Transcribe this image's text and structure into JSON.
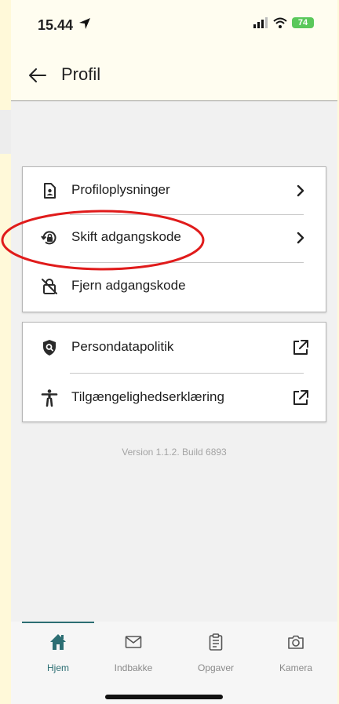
{
  "status": {
    "time": "15.44",
    "battery": "74"
  },
  "appbar": {
    "title": "Profil"
  },
  "card1": {
    "items": [
      {
        "label": "Profiloplysninger",
        "icon": "profile-document-icon",
        "trail": "chevron-right-icon"
      },
      {
        "label": "Skift adgangskode",
        "icon": "lock-rotate-icon",
        "trail": "chevron-right-icon"
      },
      {
        "label": "Fjern adgangskode",
        "icon": "lock-remove-icon"
      }
    ]
  },
  "card2": {
    "items": [
      {
        "label": "Persondatapolitik",
        "icon": "shield-icon",
        "trail": "external-link-icon"
      },
      {
        "label": "Tilgængelighedserklæring",
        "icon": "accessibility-icon",
        "trail": "external-link-icon"
      }
    ]
  },
  "version": "Version 1.1.2. Build 6893",
  "nav": [
    {
      "label": "Hjem",
      "icon": "home-icon",
      "active": true
    },
    {
      "label": "Indbakke",
      "icon": "mail-icon",
      "active": false
    },
    {
      "label": "Opgaver",
      "icon": "clipboard-icon",
      "active": false
    },
    {
      "label": "Kamera",
      "icon": "camera-icon",
      "active": false
    }
  ],
  "colors": {
    "accent": "#2c6e73",
    "annotation": "#e01b1b",
    "battery": "#5ac85a"
  }
}
